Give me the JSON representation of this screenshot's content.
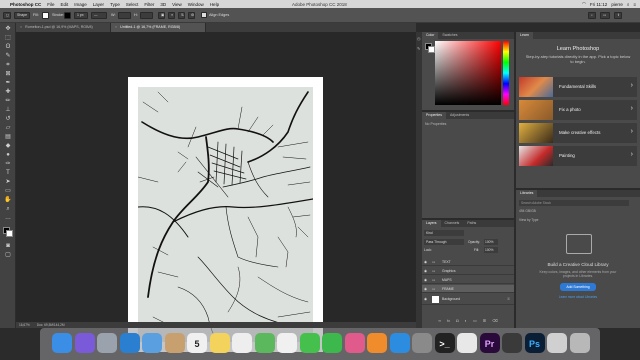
{
  "menubar": {
    "app_name": "Photoshop CC",
    "items": [
      "File",
      "Edit",
      "Image",
      "Layer",
      "Type",
      "Select",
      "Filter",
      "3D",
      "View",
      "Window",
      "Help"
    ],
    "window_title": "Adobe Photoshop CC 2018",
    "time": "Fri 11:12",
    "user": "pierre"
  },
  "options": {
    "shape_mode": "Shape",
    "fill_label": "Fill:",
    "stroke_label": "Stroke:",
    "stroke_width": "1 px",
    "w_label": "W:",
    "h_label": "H:",
    "align_edges": "Align Edges"
  },
  "tabs": [
    {
      "label": "Rumelton-1.psd @ 16,9% (MAPS, RGB/8)"
    },
    {
      "label": "Untitled-1 @ 16,7% (FRAME, RGB/8)"
    }
  ],
  "status": {
    "zoom": "16,67%",
    "doc_size": "Doc: 69,5M/144,2M"
  },
  "color_panel": {
    "tabs": [
      "Color",
      "Swatches"
    ],
    "fg_color": "#000000",
    "bg_color": "#ffffff"
  },
  "properties_panel": {
    "tabs": [
      "Properties",
      "Adjustments"
    ],
    "empty_text": "No Properties"
  },
  "layers_panel": {
    "tabs": [
      "Layers",
      "Channels",
      "Paths"
    ],
    "filter_label": "Kind",
    "blend_mode": "Pass Through",
    "opacity_label": "Opacity:",
    "opacity_value": "100%",
    "lock_label": "Lock:",
    "fill_label": "Fill:",
    "fill_value": "100%",
    "layers": [
      {
        "name": "TEXT",
        "type": "folder"
      },
      {
        "name": "Graphics",
        "type": "folder"
      },
      {
        "name": "MAPS",
        "type": "folder"
      },
      {
        "name": "FRAME",
        "type": "folder"
      },
      {
        "name": "Background",
        "type": "layer"
      }
    ]
  },
  "learn_panel": {
    "tab": "Learn",
    "title": "Learn Photoshop",
    "description": "Step-by-step tutorials directly in the app. Pick a topic below to begin.",
    "topics": [
      {
        "label": "Fundamental Skills"
      },
      {
        "label": "Fix a photo"
      },
      {
        "label": "Make creative effects"
      },
      {
        "label": "Painting"
      }
    ]
  },
  "libraries_panel": {
    "tab": "Libraries",
    "search_placeholder": "Search Adobe Stock",
    "storage": "494 GB/GB",
    "view_by": "View by Type",
    "title": "Build a Creative Cloud Library",
    "body": "Keep colors, images, and other elements from your projects in Libraries.",
    "cta_label": "Add Something",
    "learn_more": "Learn more about Libraries"
  },
  "dock": {
    "items": [
      {
        "name": "finder",
        "color": "#3a8ee6"
      },
      {
        "name": "siri",
        "color": "#7a5ad8"
      },
      {
        "name": "launchpad",
        "color": "#9aa3ad"
      },
      {
        "name": "safari",
        "color": "#2a7fd0"
      },
      {
        "name": "mail",
        "color": "#5aa0e0"
      },
      {
        "name": "contacts",
        "color": "#c8a070"
      },
      {
        "name": "calendar",
        "color": "#f0f0f0",
        "text": "5"
      },
      {
        "name": "notes",
        "color": "#f3d35c"
      },
      {
        "name": "reminders",
        "color": "#eeeeee"
      },
      {
        "name": "maps",
        "color": "#5cb85c"
      },
      {
        "name": "photos",
        "color": "#f0f0f0"
      },
      {
        "name": "messages",
        "color": "#45c04d"
      },
      {
        "name": "facetime",
        "color": "#3cb84c"
      },
      {
        "name": "itunes",
        "color": "#e05a8c"
      },
      {
        "name": "ibooks",
        "color": "#f08c2c"
      },
      {
        "name": "app-store",
        "color": "#2c8ce0"
      },
      {
        "name": "system-preferences",
        "color": "#8a8a8a"
      },
      {
        "name": "terminal",
        "color": "#222222",
        "text": ">_"
      },
      {
        "name": "chrome",
        "color": "#e8e8e8"
      },
      {
        "name": "premiere",
        "color": "#2a0a3a",
        "text": "Pr"
      },
      {
        "name": "quicktime",
        "color": "#3a3a3a"
      },
      {
        "name": "photoshop",
        "color": "#0a1e36",
        "text": "Ps"
      },
      {
        "name": "files",
        "color": "#d0d0d0"
      },
      {
        "name": "trash",
        "color": "#b8b8b8"
      }
    ]
  }
}
